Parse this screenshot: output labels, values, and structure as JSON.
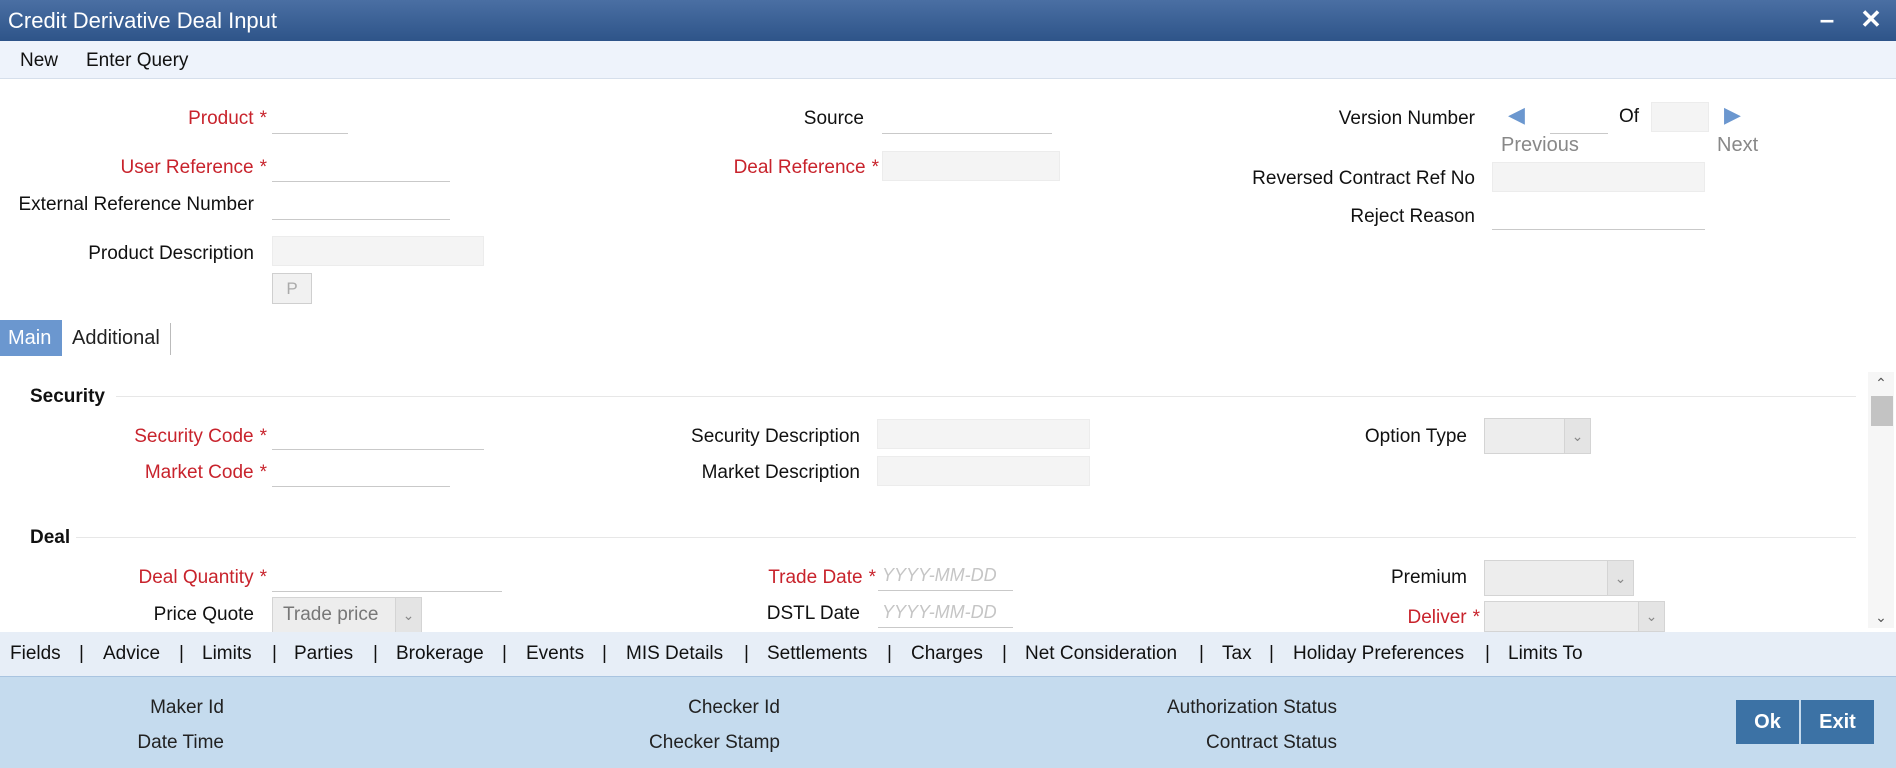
{
  "window": {
    "title": "Credit Derivative Deal Input",
    "minimize_icon": "minimize-icon",
    "close_icon": "close-icon"
  },
  "menu": {
    "new": "New",
    "enter_query": "Enter Query"
  },
  "header": {
    "product": "Product",
    "user_reference": "User Reference",
    "external_reference_number": "External Reference Number",
    "product_description": "Product Description",
    "p_button": "P",
    "source": "Source",
    "deal_reference": "Deal Reference",
    "version_number": "Version Number",
    "of": "Of",
    "previous": "Previous",
    "next": "Next",
    "reversed_contract_ref_no": "Reversed Contract Ref No",
    "reject_reason": "Reject Reason",
    "required_mark": "*"
  },
  "tabs": {
    "main": "Main",
    "additional": "Additional"
  },
  "security": {
    "title": "Security",
    "security_code": "Security Code",
    "market_code": "Market Code",
    "security_description": "Security Description",
    "market_description": "Market Description",
    "option_type": "Option Type"
  },
  "deal": {
    "title": "Deal",
    "deal_quantity": "Deal Quantity",
    "price_quote": "Price Quote",
    "price_quote_value": "Trade price",
    "trade_date": "Trade Date",
    "dstl_date": "DSTL Date",
    "date_placeholder": "YYYY-MM-DD",
    "premium": "Premium",
    "deliver": "Deliver"
  },
  "bottom_tabs": [
    "Fields",
    "Advice",
    "Limits",
    "Parties",
    "Brokerage",
    "Events",
    "MIS Details",
    "Settlements",
    "Charges",
    "Net Consideration",
    "Tax",
    "Holiday Preferences",
    "Limits To"
  ],
  "bottom_tab_separator": "|",
  "footer": {
    "maker_id": "Maker Id",
    "date_time": "Date Time",
    "checker_id": "Checker Id",
    "checker_stamp": "Checker Stamp",
    "authorization_status": "Authorization Status",
    "contract_status": "Contract Status",
    "ok": "Ok",
    "exit": "Exit"
  },
  "colors": {
    "title_bar": "#2e5489",
    "required": "#c8232c",
    "active_tab": "#6b97cf",
    "footer": "#c5dbee",
    "footer_button": "#3c72a5"
  }
}
